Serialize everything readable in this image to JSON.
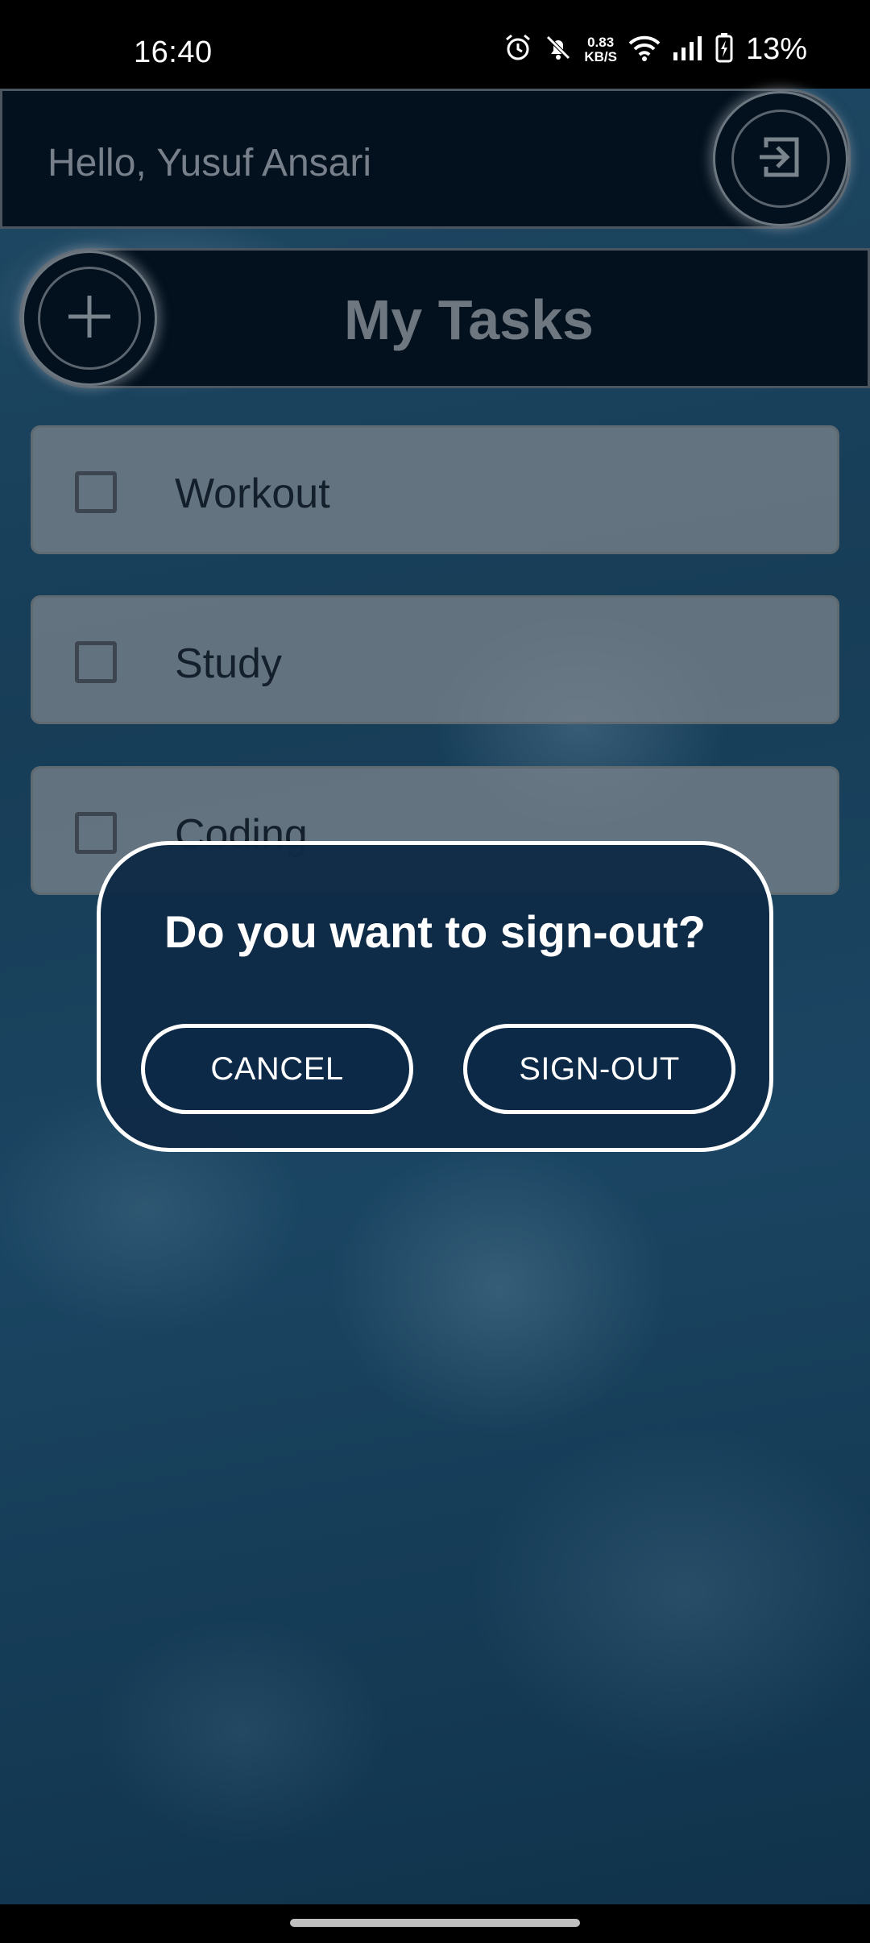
{
  "status_bar": {
    "time": "16:40",
    "net_speed_value": "0.83",
    "net_speed_unit": "KB/S",
    "battery": "13%",
    "icons": [
      "alarm-icon",
      "muted-bell-icon",
      "wifi-icon",
      "signal-icon",
      "battery-charging-icon"
    ]
  },
  "header": {
    "greeting": "Hello, Yusuf Ansari",
    "signout_icon": "sign-out-icon"
  },
  "tasks_header": {
    "title": "My Tasks",
    "add_icon": "plus-icon"
  },
  "tasks": [
    {
      "label": "Workout",
      "checked": false
    },
    {
      "label": "Study",
      "checked": false
    },
    {
      "label": "Coding",
      "checked": false
    }
  ],
  "dialog": {
    "title": "Do you want to sign-out?",
    "cancel_label": "CANCEL",
    "confirm_label": "SIGN-OUT"
  },
  "colors": {
    "header_bg": "#03111e",
    "dialog_bg": "#0e2a46",
    "dialog_border": "#ffffff"
  }
}
